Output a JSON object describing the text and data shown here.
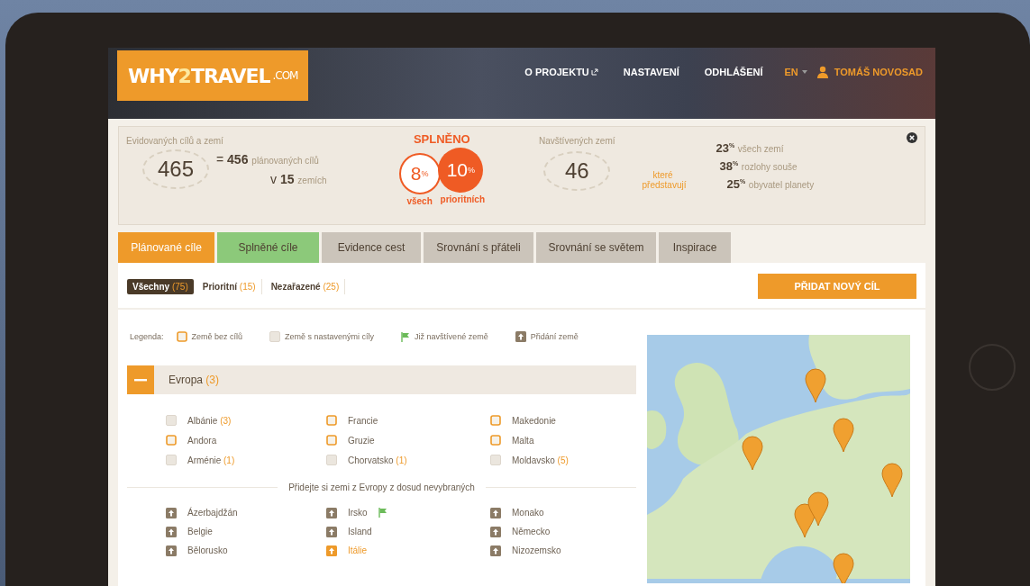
{
  "header": {
    "logo": {
      "before": "WHY",
      "accent": "2",
      "after": "TRAVEL",
      "suffix": ".COM"
    },
    "nav": [
      {
        "label": "O PROJEKTU",
        "external": true
      },
      {
        "label": "NASTAVENÍ",
        "external": false
      },
      {
        "label": "ODHLÁŠENÍ",
        "external": false
      }
    ],
    "language": "EN",
    "user": "TOMÁŠ NOVOSAD"
  },
  "stats": {
    "tracked": {
      "label": "Evidovaných cílů a zemí",
      "value": "465"
    },
    "planned": {
      "prefix": "=",
      "value": "456",
      "label": "plánovaných cílů"
    },
    "countries": {
      "prefix": "v",
      "value": "15",
      "label": "zemích"
    },
    "done": {
      "title": "SPLNĚNO",
      "circles": [
        {
          "value": "8$^{%}$",
          "label": "všech",
          "kind": "outline"
        },
        {
          "value": "10$^{%}$",
          "label": "prioritních",
          "kind": "filled"
        }
      ]
    },
    "visited": {
      "label": "Navštívených zemí",
      "value": "46"
    },
    "connector": "které představují",
    "shares": [
      {
        "value": "23$^{%}$",
        "label": "všech zemí"
      },
      {
        "value": "38$^{%}$",
        "label": "rozlohy souše"
      },
      {
        "value": "25$^{%}$",
        "label": "obyvatel planety"
      }
    ]
  },
  "tabs": [
    {
      "label": "Plánované cíle",
      "selected": true,
      "color": "#ee9a2a"
    },
    {
      "label": "Splněné cíle",
      "selected": false,
      "color": "#8cc97a"
    },
    {
      "label": "Evidence cest",
      "selected": false,
      "color": "#cbc4ba"
    },
    {
      "label": "Srovnání s přáteli",
      "selected": false,
      "color": "#cbc4ba"
    },
    {
      "label": "Srovnání se světem",
      "selected": false,
      "color": "#cbc4ba"
    },
    {
      "label": "Inspirace",
      "selected": false,
      "color": "#cbc4ba"
    }
  ],
  "filters": [
    {
      "label": "Všechny",
      "count": "(75)",
      "selected": true
    },
    {
      "label": "Prioritní",
      "count": "(15)",
      "selected": false
    },
    {
      "label": "Nezařazené",
      "count": "(25)",
      "selected": false
    }
  ],
  "add_button": "PŘIDAT NOVÝ CÍL",
  "legend": {
    "label": "Legenda:",
    "items": [
      {
        "kind": "no-goals",
        "label": "Země bez cílů"
      },
      {
        "kind": "with-goals",
        "label": "Země s nastavenými cíly"
      },
      {
        "kind": "visited",
        "label": "Již navštívené země"
      },
      {
        "kind": "add",
        "label": "Přidání země"
      }
    ]
  },
  "region": {
    "name": "Evropa",
    "count": "(3)",
    "expanded": true,
    "countries": [
      {
        "name": "Albánie",
        "count": "(3)",
        "has_goals": true
      },
      {
        "name": "Andora",
        "has_goals": false
      },
      {
        "name": "Arménie",
        "count": "(1)",
        "has_goals": true
      },
      {
        "name": "Francie",
        "has_goals": false
      },
      {
        "name": "Gruzie",
        "has_goals": false
      },
      {
        "name": "Chorvatsko",
        "count": "(1)",
        "has_goals": true
      },
      {
        "name": "Makedonie",
        "has_goals": false
      },
      {
        "name": "Malta",
        "has_goals": false
      },
      {
        "name": "Moldavsko",
        "count": "(5)",
        "has_goals": true
      }
    ],
    "add_title": "Přidejte si zemi z Evropy z dosud nevybraných",
    "addable": [
      {
        "name": "Ázerbajdžán",
        "selected": false,
        "visited": false
      },
      {
        "name": "Belgie",
        "selected": false,
        "visited": false
      },
      {
        "name": "Bělorusko",
        "selected": false,
        "visited": false
      },
      {
        "name": "Irsko",
        "selected": false,
        "visited": true
      },
      {
        "name": "Island",
        "selected": false,
        "visited": false
      },
      {
        "name": "Itálie",
        "selected": true,
        "visited": false
      },
      {
        "name": "Monako",
        "selected": false,
        "visited": false
      },
      {
        "name": "Německo",
        "selected": false,
        "visited": false
      },
      {
        "name": "Nizozemsko",
        "selected": false,
        "visited": false
      }
    ]
  }
}
